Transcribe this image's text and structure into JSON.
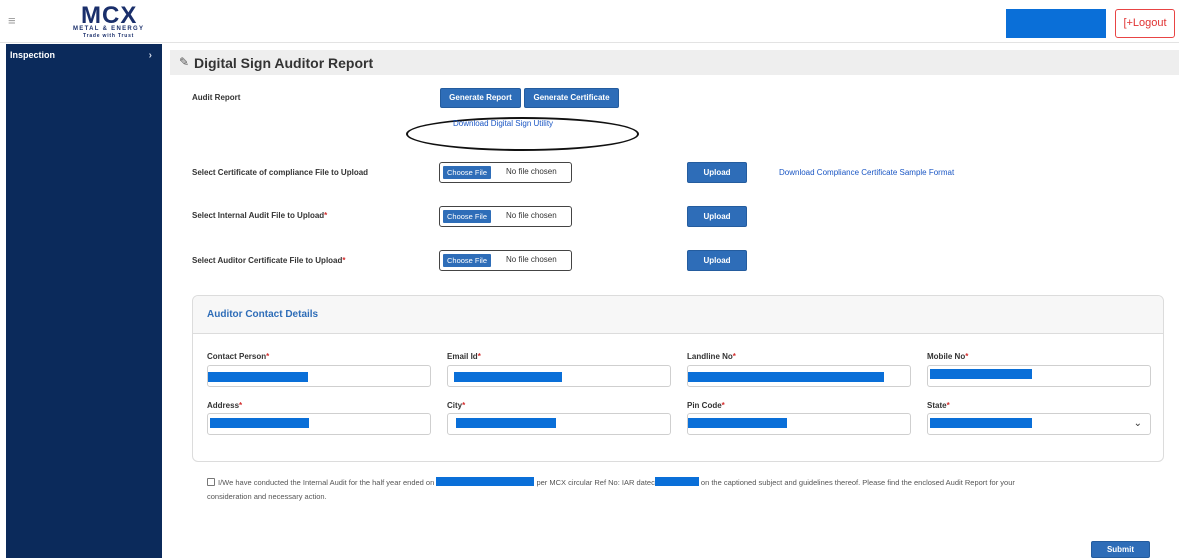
{
  "header": {
    "menu_icon": "hamburger-icon",
    "logo": {
      "brand": "MCX",
      "line1": "METAL & ENERGY",
      "line2": "Trade with Trust"
    },
    "logout_label": "[+Logout",
    "colors": {
      "redaction": "#0a6fd8",
      "logout": "#e03131"
    }
  },
  "sidebar": {
    "items": [
      {
        "label": "Inspection",
        "icon": "chevron-right-icon"
      }
    ],
    "color": "#0b2a5b"
  },
  "page": {
    "title": "Digital Sign Auditor Report",
    "title_icon": "pencil-icon"
  },
  "audit": {
    "label": "Audit Report",
    "generate_report": "Generate Report",
    "generate_certificate": "Generate Certificate",
    "download_utility": "Download Digital Sign Utility"
  },
  "uploads": [
    {
      "label": "Select Certificate of compliance File to Upload",
      "required": false,
      "choose": "Choose File",
      "status": "No file chosen",
      "upload": "Upload",
      "link": "Download Compliance Certificate Sample Format"
    },
    {
      "label": "Select Internal Audit File to Upload",
      "required": true,
      "choose": "Choose File",
      "status": "No file chosen",
      "upload": "Upload"
    },
    {
      "label": "Select Auditor Certificate File to Upload",
      "required": true,
      "choose": "Choose File",
      "status": "No file chosen",
      "upload": "Upload"
    }
  ],
  "contact": {
    "title": "Auditor Contact Details",
    "fields": [
      {
        "label": "Contact Person"
      },
      {
        "label": "Email Id"
      },
      {
        "label": "Landline No"
      },
      {
        "label": "Mobile No"
      },
      {
        "label": "Address"
      },
      {
        "label": "City"
      },
      {
        "label": "Pin Code"
      },
      {
        "label": "State",
        "select": true
      }
    ]
  },
  "declaration": {
    "part1": "I/We have conducted the Internal Audit for the half year ended on",
    "part2": "per MCX circular Ref No: IAR datec",
    "part3": "on the captioned subject and guidelines thereof. Please find the enclosed Audit Report for your",
    "part4": "consideration and necessary action."
  },
  "submit_label": "Submit",
  "required_mark": "*"
}
